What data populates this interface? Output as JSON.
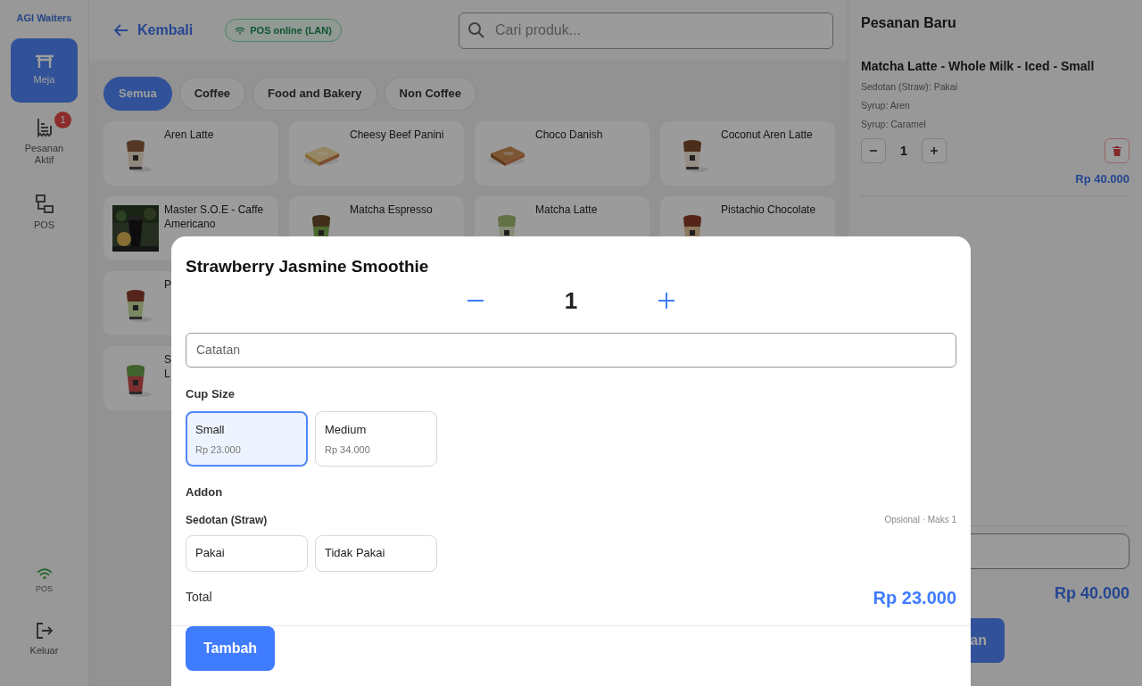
{
  "app": {
    "brand": "AGI Waiters"
  },
  "sidebar": {
    "items": [
      {
        "label": "Meja",
        "selected": true
      },
      {
        "label": "Pesanan Aktif",
        "selected": false,
        "badge": "1"
      },
      {
        "label": "POS",
        "selected": false
      }
    ],
    "connection": {
      "label": "POS",
      "online": true
    },
    "logout": {
      "label": "Keluar"
    }
  },
  "header": {
    "back": "Kembali",
    "status": "POS online (LAN)",
    "search": {
      "placeholder": "Cari produk..."
    }
  },
  "categories": [
    {
      "label": "Semua",
      "selected": true
    },
    {
      "label": "Coffee",
      "selected": false
    },
    {
      "label": "Food and Bakery",
      "selected": false
    },
    {
      "label": "Non Coffee",
      "selected": false
    }
  ],
  "products": [
    {
      "name": "Aren Latte"
    },
    {
      "name": "Cheesy Beef Panini"
    },
    {
      "name": "Choco Danish"
    },
    {
      "name": "Coconut Aren Latte"
    },
    {
      "name": "Master S.O.E - Caffe Americano"
    },
    {
      "name": "Matcha Espresso"
    },
    {
      "name": "Matcha Latte"
    },
    {
      "name": "Pistachio Chocolate"
    },
    {
      "name": "P"
    },
    {
      "name": "S\nL"
    }
  ],
  "order": {
    "title": "Pesanan Baru",
    "items": [
      {
        "name": "Matcha Latte - Whole Milk - Iced - Small",
        "details": [
          "Sedotan (Straw): Pakai",
          "Syrup: Aren",
          "Syrup: Caramel"
        ],
        "quantity": "1",
        "price": "Rp 40.000"
      }
    ],
    "total": "Rp 40.000",
    "submit": "an"
  },
  "modal": {
    "title": "Strawberry Jasmine Smoothie",
    "quantity": "1",
    "note": {
      "placeholder": "Catatan"
    },
    "cup_size": {
      "label": "Cup Size",
      "options": [
        {
          "label": "Small",
          "price": "Rp 23.000",
          "selected": true
        },
        {
          "label": "Medium",
          "price": "Rp 34.000",
          "selected": false
        }
      ]
    },
    "addon": {
      "label": "Addon",
      "groups": [
        {
          "name": "Sedotan (Straw)",
          "rule": "Opsional · Maks 1",
          "options": [
            {
              "label": "Pakai",
              "selected": false
            },
            {
              "label": "Tidak Pakai",
              "selected": false
            }
          ]
        }
      ]
    },
    "total_label": "Total",
    "total": "Rp 23.000",
    "submit": "Tambah"
  }
}
